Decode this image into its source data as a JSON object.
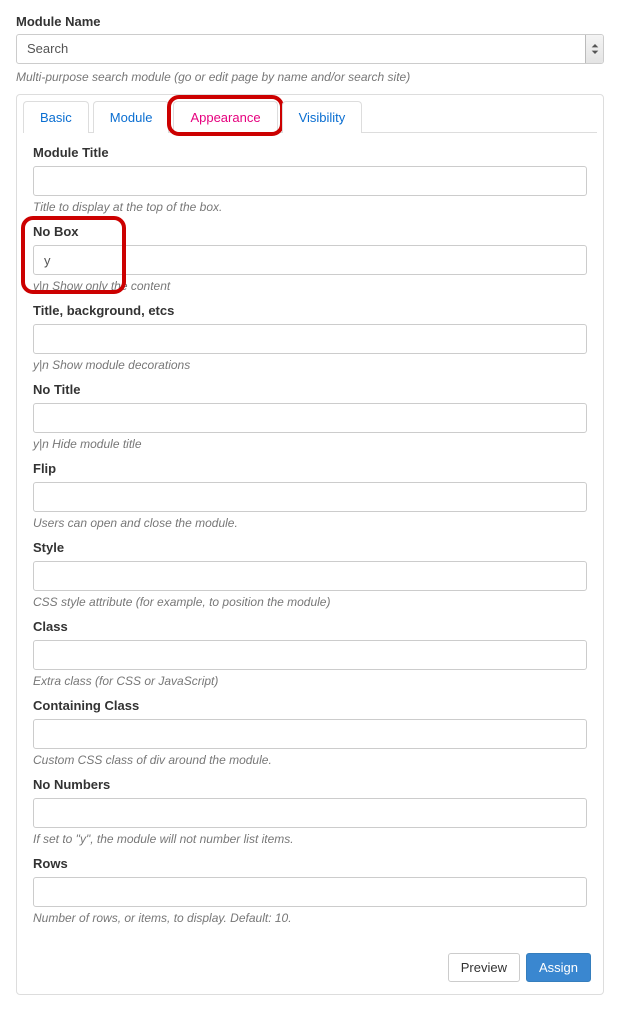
{
  "moduleNameLabel": "Module Name",
  "moduleNameValue": "Search",
  "moduleNameHelp": "Multi-purpose search module (go or edit page by name and/or search site)",
  "tabs": {
    "basic": "Basic",
    "module": "Module",
    "appearance": "Appearance",
    "visibility": "Visibility"
  },
  "fields": {
    "moduleTitle": {
      "label": "Module Title",
      "value": "",
      "desc": "Title to display at the top of the box."
    },
    "noBox": {
      "label": "No Box",
      "value": "y",
      "desc": "y|n Show only the content"
    },
    "titleBg": {
      "label": "Title, background, etcs",
      "value": "",
      "desc": "y|n Show module decorations"
    },
    "noTitle": {
      "label": "No Title",
      "value": "",
      "desc": "y|n Hide module title"
    },
    "flip": {
      "label": "Flip",
      "value": "",
      "desc": "Users can open and close the module."
    },
    "style": {
      "label": "Style",
      "value": "",
      "desc": "CSS style attribute (for example, to position the module)"
    },
    "class": {
      "label": "Class",
      "value": "",
      "desc": "Extra class (for CSS or JavaScript)"
    },
    "containingClass": {
      "label": "Containing Class",
      "value": "",
      "desc": "Custom CSS class of div around the module."
    },
    "noNumbers": {
      "label": "No Numbers",
      "value": "",
      "desc": "If set to \"y\", the module will not number list items."
    },
    "rows": {
      "label": "Rows",
      "value": "",
      "desc": "Number of rows, or items, to display. Default: 10."
    }
  },
  "buttons": {
    "preview": "Preview",
    "assign": "Assign"
  }
}
